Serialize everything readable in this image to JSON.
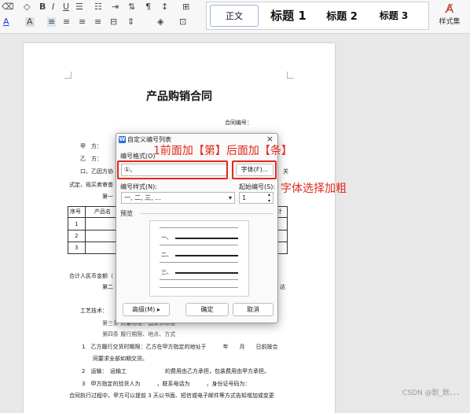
{
  "ribbon": {
    "row1_icons": [
      "paste-format-icon",
      "eraser-icon",
      "bold-b-icon",
      "italic-icon",
      "underline-icon",
      "strike-icon",
      "superscript-icon",
      "subscript-icon",
      "bullets-icon",
      "numbering-icon",
      "outdent-icon",
      "indent-icon",
      "sort-icon",
      "show-marks-icon"
    ],
    "styles": {
      "normal": "正文",
      "h1": "标题 1",
      "h2": "标题 2",
      "h3": "标题 3",
      "style_set": "样式集"
    }
  },
  "document": {
    "title": "产品购销合同",
    "contract_no": "合同编号：",
    "party_a": "甲　方：",
    "party_b": "乙　方：",
    "line3": "口、乙因方协",
    "line3_tail": "关",
    "agreement": "式定，规买卖审查",
    "article1": "第一",
    "table_header_no": "序号",
    "table_header_name": "产品名",
    "table_rows": [
      "1",
      "2",
      "3"
    ],
    "table_col_end": "计",
    "total": "合计人民币金额（",
    "article2_tail": "第二",
    "deliver_tail": "达",
    "quality": "工艺技术：",
    "article3": "第三条",
    "article3_text": "质量标准：国家质标准",
    "article4": "第四条",
    "article4_text": "履行期限、地点、方式",
    "clause1": "1　乙方履行交货时期限：乙方在甲方指定的地址于　　　年　　月　　日前按合",
    "clause1b": "同要求全部如期交货。",
    "clause2": "2　运输：　运输工　　　　　　　的费用由乙方承担，包装费用由甲方承担。",
    "clause3": "3　甲方指定的验货人为　　　，联系电话为　　　，身份证号码为：",
    "clause4": "合同执行过程中，甲方可以提前 3 天以书面、短信或电子邮件等方式告知增加或变更"
  },
  "dialog": {
    "title": "自定义编号列表",
    "close": "×",
    "format_label": "编号格式(O)",
    "format_value": "①、",
    "font_button": "字体(F)...",
    "style_label": "编号样式(N):",
    "style_value": "一, 二, 三, ...",
    "start_label": "起始编号(S):",
    "start_value": "1",
    "preview_label": "预览",
    "preview_items": [
      "一、",
      "二、",
      "三、"
    ],
    "advanced_button": "高级(M) ▸",
    "ok_button": "确定",
    "cancel_button": "取消"
  },
  "annotations": {
    "top": "1前面加【第】后面加【条】",
    "right": "字体选择加粗"
  },
  "watermark": "CSDN @默_默、、、",
  "colors": {
    "annotation_red": "#e2281a",
    "dialog_icon_blue": "#2f6fd6"
  }
}
